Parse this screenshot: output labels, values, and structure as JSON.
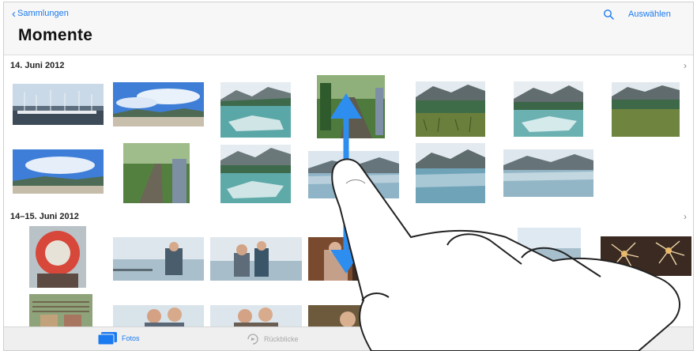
{
  "nav": {
    "back_label": "Sammlungen",
    "select_label": "Auswählen",
    "title": "Momente",
    "search_icon": "search-icon"
  },
  "sections": [
    {
      "label": "14. Juni 2012"
    },
    {
      "label": "14–15. Juni 2012"
    }
  ],
  "tabs": [
    {
      "label": "Fotos",
      "icon": "photos-icon",
      "selected": true
    },
    {
      "label": "Rückblicke",
      "icon": "memories-icon",
      "selected": false
    }
  ],
  "colors": {
    "accent": "#1a7af0",
    "arrow": "#2d8ef0",
    "background": "#ffffff",
    "bar": "#f7f7f7"
  }
}
